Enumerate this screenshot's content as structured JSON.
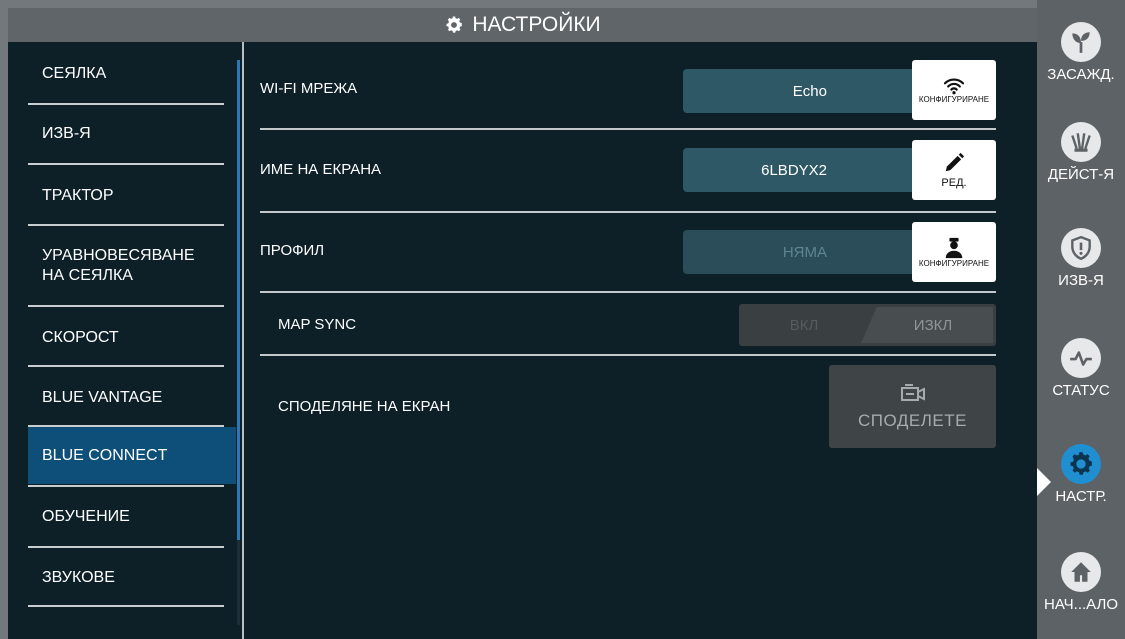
{
  "header": {
    "title": "НАСТРОЙКИ",
    "icon": "gear-icon"
  },
  "menu": {
    "items": [
      {
        "label": "СЕЯЛКА"
      },
      {
        "label": "ИЗВ-Я"
      },
      {
        "label": "ТРАКТОР"
      },
      {
        "label": "УРАВНОВЕСЯВАНЕ НА СЕЯЛКА"
      },
      {
        "label": "СКОРОСТ"
      },
      {
        "label": "BLUE VANTAGE"
      },
      {
        "label": "BLUE CONNECT"
      },
      {
        "label": "ОБУЧЕНИЕ"
      },
      {
        "label": "ЗВУКОВЕ"
      }
    ],
    "active_index": 6
  },
  "settings": {
    "wifi": {
      "label": "WI-FI МРЕЖА",
      "value": "Echo",
      "button_label": "КОНФИГУРИРАНЕ",
      "button_icon": "wifi-icon"
    },
    "display_name": {
      "label": "ИМЕ НА ЕКРАНА",
      "value": "6LBDYX2",
      "button_label": "РЕД.",
      "button_icon": "pencil-icon"
    },
    "profile": {
      "label": "ПРОФИЛ",
      "value": "НЯМА",
      "button_label": "КОНФИГУРИРАНЕ",
      "button_icon": "person-icon"
    },
    "map_sync": {
      "label": "MAP SYNC",
      "on_label": "ВКЛ",
      "off_label": "ИЗКЛ",
      "selected": "ИЗКЛ"
    },
    "screen_share": {
      "label": "СПОДЕЛЯНЕ НА ЕКРАН",
      "button_label": "СПОДЕЛЕТЕ",
      "button_icon": "camera-icon"
    }
  },
  "rail": {
    "items": [
      {
        "label": "ЗАСАЖД.",
        "icon": "seedling-icon"
      },
      {
        "label": "ДЕЙСТ-Я",
        "icon": "actions-icon"
      },
      {
        "label": "ИЗВ-Я",
        "icon": "alert-shield-icon"
      },
      {
        "label": "СТАТУС",
        "icon": "pulse-icon"
      },
      {
        "label": "НАСТР.",
        "icon": "gear-icon"
      },
      {
        "label": "НАЧ...АЛО",
        "icon": "home-icon"
      }
    ],
    "active_index": 4
  },
  "colors": {
    "accent": "#1f8fd1",
    "active_menu": "#0e4f7a",
    "panel_bg": "#0d2028",
    "field_bg": "#2e5865"
  }
}
